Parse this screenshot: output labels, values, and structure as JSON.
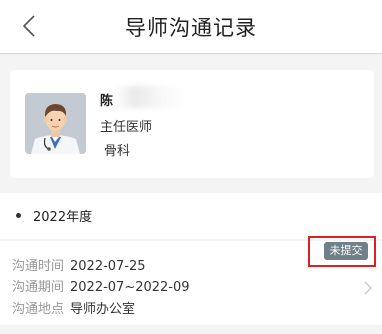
{
  "header": {
    "back_icon": "chevron-left-icon",
    "title": "导师沟通记录"
  },
  "doctor": {
    "name": "陈",
    "title": "主任医师",
    "department": "骨科"
  },
  "year_section": {
    "label": "2022年度"
  },
  "record": {
    "status": "未提交",
    "rows": [
      {
        "label": "沟通时间",
        "value": "2022-07-25"
      },
      {
        "label": "沟通期间",
        "value": "2022-07~2022-09"
      },
      {
        "label": "沟通地点",
        "value": "导师办公室"
      }
    ]
  },
  "colors": {
    "badge_bg": "#6f8088",
    "highlight": "#e02020",
    "background": "#f4f4f4"
  }
}
